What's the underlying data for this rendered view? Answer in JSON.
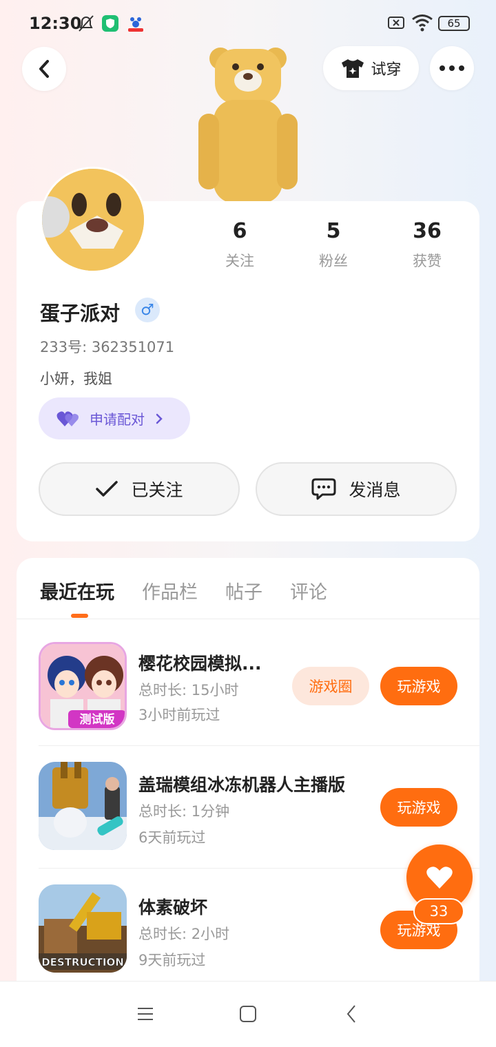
{
  "status_bar": {
    "time": "12:30",
    "battery": "65"
  },
  "top_bar": {
    "try_on_label": "试穿"
  },
  "profile": {
    "stats": [
      {
        "value": "6",
        "label": "关注"
      },
      {
        "value": "5",
        "label": "粉丝"
      },
      {
        "value": "36",
        "label": "获赞"
      }
    ],
    "name": "蛋子派对",
    "gender_symbol": "♂",
    "uid": "233号: 362351071",
    "bio": "小妍，我姐",
    "pair_label": "申请配对",
    "followed_label": "已关注",
    "message_label": "发消息"
  },
  "tabs": [
    "最近在玩",
    "作品栏",
    "帖子",
    "评论"
  ],
  "games": [
    {
      "title": "樱花校园模拟...",
      "duration": "总时长: 15小时",
      "last_played": "3小时前玩过",
      "circle_label": "游戏圈",
      "play_label": "玩游戏",
      "icon_text": "测试版"
    },
    {
      "title": "盖瑞模组冰冻机器人主播版",
      "duration": "总时长: 1分钟",
      "last_played": "6天前玩过",
      "play_label": "玩游戏"
    },
    {
      "title": "体素破坏",
      "duration": "总时长: 2小时",
      "last_played": "9天前玩过",
      "play_label": "玩游戏",
      "icon_text": "DESTRUCTION"
    }
  ],
  "fab": {
    "count": "33"
  },
  "colors": {
    "accent": "#ff6d10",
    "pair": "#6a57d6"
  }
}
